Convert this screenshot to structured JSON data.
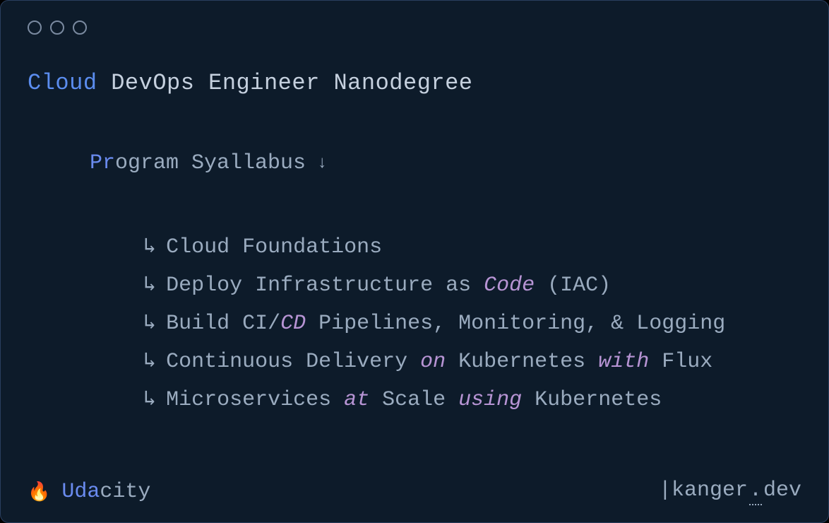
{
  "title": {
    "highlight": "Cloud",
    "rest": " DevOps Engineer Nanodegree"
  },
  "syllabus": {
    "header": {
      "hl": "Pr",
      "rest": "ogram Syallabus",
      "arrow": "↓"
    },
    "items": [
      {
        "arrow": "↳",
        "parts": [
          {
            "t": "Cloud Foundations",
            "k": false
          }
        ]
      },
      {
        "arrow": "↳",
        "parts": [
          {
            "t": "Deploy Infrastructure as ",
            "k": false
          },
          {
            "t": "Code",
            "k": true
          },
          {
            "t": " (IAC)",
            "k": false
          }
        ]
      },
      {
        "arrow": "↳",
        "parts": [
          {
            "t": "Build CI/",
            "k": false
          },
          {
            "t": "CD",
            "k": true
          },
          {
            "t": " Pipelines, Monitoring, & Logging",
            "k": false
          }
        ]
      },
      {
        "arrow": "↳",
        "parts": [
          {
            "t": "Continuous Delivery ",
            "k": false
          },
          {
            "t": "on",
            "k": true
          },
          {
            "t": " Kubernetes ",
            "k": false
          },
          {
            "t": "with",
            "k": true
          },
          {
            "t": " Flux",
            "k": false
          }
        ]
      },
      {
        "arrow": "↳",
        "parts": [
          {
            "t": "Microservices ",
            "k": false
          },
          {
            "t": "at",
            "k": true
          },
          {
            "t": " Scale ",
            "k": false
          },
          {
            "t": "using",
            "k": true
          },
          {
            "t": " Kubernetes",
            "k": false
          }
        ]
      }
    ]
  },
  "footer": {
    "fire": "🔥",
    "brand_hl": "Uda",
    "brand_rest": "city",
    "right_pipe": "| ",
    "right_a": "kanger",
    "right_dot": ".",
    "right_b": "dev"
  }
}
